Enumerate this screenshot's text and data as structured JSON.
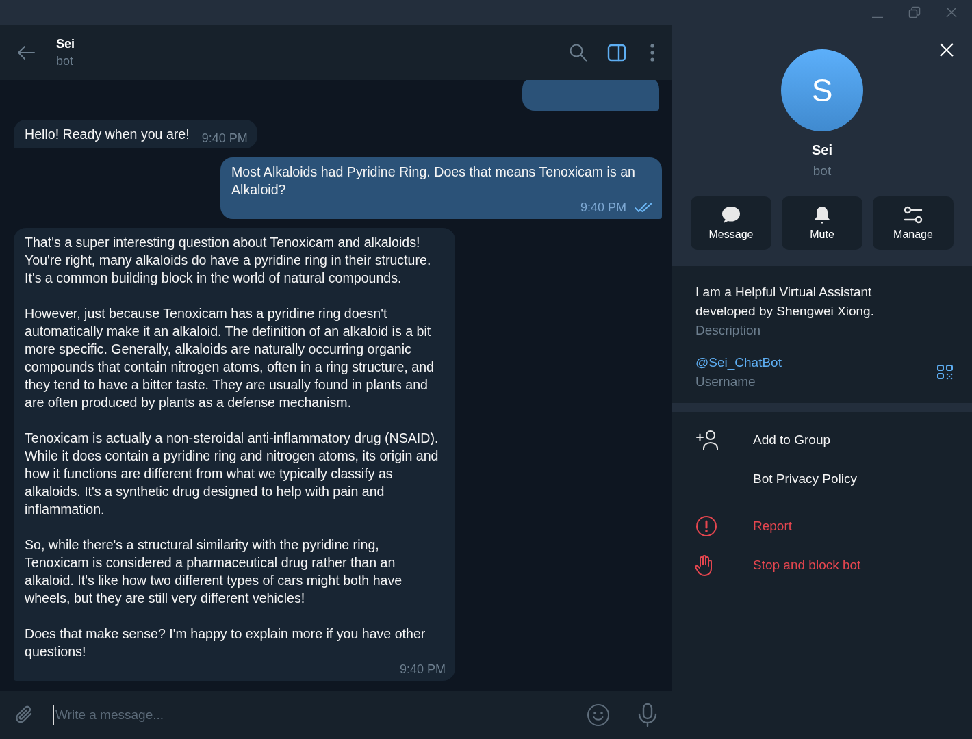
{
  "chat": {
    "title": "Sei",
    "subtitle": "bot"
  },
  "messages": [
    {
      "kind": "incoming",
      "paragraphs": [
        "Hello! Ready when you are!"
      ],
      "time": "9:40 PM"
    },
    {
      "kind": "outgoing",
      "paragraphs": [
        "Most Alkaloids had Pyridine Ring. Does that means Tenoxicam is an Alkaloid?"
      ],
      "time": "9:40 PM",
      "read": true
    },
    {
      "kind": "incoming",
      "paragraphs": [
        "That's a super interesting question about Tenoxicam and alkaloids! You're right, many alkaloids do have a pyridine ring in their structure. It's a common building block in the world of natural compounds.",
        "However, just because Tenoxicam has a pyridine ring doesn't automatically make it an alkaloid. The definition of an alkaloid is a bit more specific. Generally, alkaloids are naturally occurring organic compounds that contain nitrogen atoms, often in a ring structure, and they tend to have a bitter taste. They are usually found in plants and are often produced by plants as a defense mechanism.",
        "Tenoxicam is actually a non-steroidal anti-inflammatory drug (NSAID). While it does contain a pyridine ring and nitrogen atoms, its origin and how it functions are different from what we typically classify as alkaloids. It's a synthetic drug designed to help with pain and inflammation.",
        "So, while there's a structural similarity with the pyridine ring, Tenoxicam is considered a pharmaceutical drug rather than an alkaloid. It's like how two different types of cars might both have wheels, but they are still very different vehicles!",
        "Does that make sense? I'm happy to explain more if you have other questions!"
      ],
      "time": "9:40 PM"
    }
  ],
  "composer": {
    "placeholder": "Write a message..."
  },
  "profile": {
    "avatar_letter": "S",
    "name": "Sei",
    "subtitle": "bot",
    "actions": [
      "Message",
      "Mute",
      "Manage"
    ],
    "description": "I am a Helpful Virtual Assistant developed by Shengwei Xiong.",
    "description_label": "Description",
    "username": "@Sei_ChatBot",
    "username_label": "Username",
    "menu": [
      {
        "label": "Add to Group",
        "danger": false
      },
      {
        "label": "Bot Privacy Policy",
        "danger": false
      },
      {
        "label": "Report",
        "danger": true
      },
      {
        "label": "Stop and block bot",
        "danger": true
      }
    ]
  }
}
